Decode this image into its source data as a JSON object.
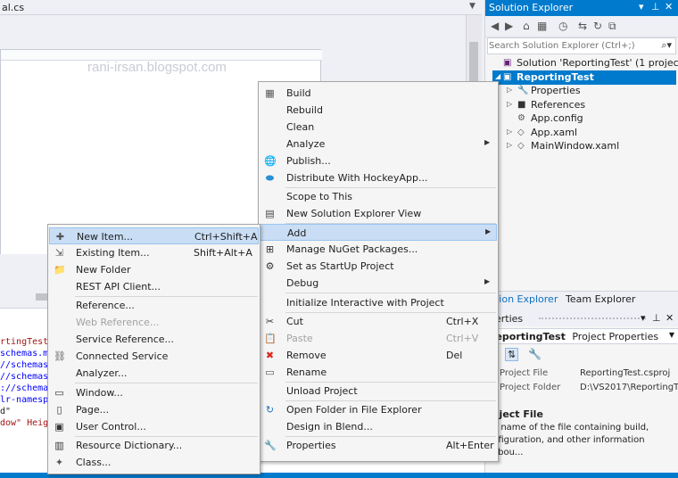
{
  "editor": {
    "tab_label": "al.cs",
    "watermark": "rani-irsan.blogspot.com",
    "xaml_lines": [
      {
        "text": "rtingTest",
        "cls": "x-red"
      },
      {
        "text": "schemas.m",
        "cls": "x-blue"
      },
      {
        "text": "//schemas",
        "cls": "x-blue"
      },
      {
        "text": "//schemas",
        "cls": "x-blue"
      },
      {
        "text": "://schema",
        "cls": "x-blue"
      },
      {
        "text": "lr-namesp",
        "cls": "x-blue"
      },
      {
        "text": "d\"",
        "cls": "x-dark"
      },
      {
        "text": "dow\" Heig",
        "cls": "x-red"
      }
    ]
  },
  "solution_explorer": {
    "title": "Solution Explorer",
    "search_placeholder": "Search Solution Explorer (Ctrl+;)",
    "tree": [
      {
        "label": "Solution 'ReportingTest' (1 project)",
        "icon": "solution-icon",
        "expander": "",
        "indent": 8,
        "selected": false
      },
      {
        "label": "ReportingTest",
        "icon": "csharp-project-icon",
        "expander": "◢",
        "indent": 8,
        "selected": true
      },
      {
        "label": "Properties",
        "icon": "wrench-icon",
        "expander": "▷",
        "indent": 24,
        "selected": false
      },
      {
        "label": "References",
        "icon": "references-icon",
        "expander": "▷",
        "indent": 24,
        "selected": false
      },
      {
        "label": "App.config",
        "icon": "config-file-icon",
        "expander": "",
        "indent": 24,
        "selected": false
      },
      {
        "label": "App.xaml",
        "icon": "xaml-file-icon",
        "expander": "▷",
        "indent": 24,
        "selected": false
      },
      {
        "label": "MainWindow.xaml",
        "icon": "xaml-file-icon",
        "expander": "▷",
        "indent": 24,
        "selected": false
      }
    ],
    "tabs": [
      "ution Explorer",
      "Team Explorer"
    ]
  },
  "properties": {
    "title": "perties",
    "object": "ReportingTest",
    "object_type": "Project Properties",
    "rows": [
      {
        "key": "Project File",
        "value": "ReportingTest.csproj"
      },
      {
        "key": "Project Folder",
        "value": "D:\\VS2017\\ReportingTe"
      }
    ],
    "desc_title": "oject File",
    "desc_text": "e name of the file containing build, nfiguration, and other information abou..."
  },
  "project_menu": {
    "items": [
      {
        "label": "Build",
        "icon": "build-icon",
        "glyph": "▦",
        "color": "#555"
      },
      {
        "label": "Rebuild"
      },
      {
        "label": "Clean"
      },
      {
        "label": "Analyze",
        "submenu": true
      },
      {
        "label": "Publish...",
        "icon": "globe-icon",
        "glyph": "🌐",
        "color": "#1e88e5"
      },
      {
        "label": "Distribute With HockeyApp...",
        "icon": "hockeyapp-icon",
        "glyph": "⬬",
        "color": "#2a8fd6"
      },
      {
        "sep": true
      },
      {
        "label": "Scope to This"
      },
      {
        "label": "New Solution Explorer View",
        "icon": "new-view-icon",
        "glyph": "▤",
        "color": "#444"
      },
      {
        "sep": true
      },
      {
        "label": "Add",
        "submenu": true,
        "highlight": true
      },
      {
        "label": "Manage NuGet Packages...",
        "icon": "nuget-icon",
        "glyph": "⊞",
        "color": "#333"
      },
      {
        "label": "Set as StartUp Project",
        "icon": "gear-icon",
        "glyph": "⚙",
        "color": "#333"
      },
      {
        "label": "Debug",
        "submenu": true
      },
      {
        "sep": true
      },
      {
        "label": "Initialize Interactive with Project"
      },
      {
        "sep": true
      },
      {
        "label": "Cut",
        "shortcut": "Ctrl+X",
        "icon": "scissors-icon",
        "glyph": "✂",
        "color": "#333"
      },
      {
        "label": "Paste",
        "shortcut": "Ctrl+V",
        "disabled": true,
        "icon": "paste-icon",
        "glyph": "📋",
        "color": "#aaa"
      },
      {
        "label": "Remove",
        "shortcut": "Del",
        "icon": "remove-icon",
        "glyph": "✖",
        "color": "#d9281e"
      },
      {
        "label": "Rename",
        "icon": "rename-icon",
        "glyph": "▭",
        "color": "#555"
      },
      {
        "sep": true
      },
      {
        "label": "Unload Project"
      },
      {
        "sep": true
      },
      {
        "label": "Open Folder in File Explorer",
        "icon": "refresh-folder-icon",
        "glyph": "↻",
        "color": "#1e6fc2"
      },
      {
        "label": "Design in Blend..."
      },
      {
        "sep": true
      },
      {
        "label": "Properties",
        "shortcut": "Alt+Enter",
        "icon": "wrench-icon",
        "glyph": "🔧",
        "color": "#333"
      }
    ]
  },
  "add_menu": {
    "items": [
      {
        "label": "New Item...",
        "shortcut": "Ctrl+Shift+A",
        "highlight": true,
        "icon": "new-item-icon",
        "glyph": "✚",
        "color": "#555"
      },
      {
        "label": "Existing Item...",
        "shortcut": "Shift+Alt+A",
        "icon": "existing-item-icon",
        "glyph": "⇲",
        "color": "#555"
      },
      {
        "label": "New Folder",
        "icon": "new-folder-icon",
        "glyph": "📁",
        "color": "#dcb253"
      },
      {
        "label": "REST API Client..."
      },
      {
        "sep": true
      },
      {
        "label": "Reference..."
      },
      {
        "label": "Web Reference...",
        "disabled": true
      },
      {
        "label": "Service Reference..."
      },
      {
        "label": "Connected Service",
        "icon": "connected-service-icon",
        "glyph": "⛓",
        "color": "#555"
      },
      {
        "label": "Analyzer..."
      },
      {
        "sep": true
      },
      {
        "label": "Window...",
        "icon": "window-icon",
        "glyph": "▭",
        "color": "#333"
      },
      {
        "label": "Page...",
        "icon": "page-icon",
        "glyph": "▯",
        "color": "#333"
      },
      {
        "label": "User Control...",
        "icon": "user-control-icon",
        "glyph": "▣",
        "color": "#333"
      },
      {
        "sep": true
      },
      {
        "label": "Resource Dictionary...",
        "icon": "resource-dictionary-icon",
        "glyph": "▥",
        "color": "#333"
      },
      {
        "label": "Class...",
        "icon": "class-icon",
        "glyph": "✦",
        "color": "#555"
      }
    ]
  }
}
